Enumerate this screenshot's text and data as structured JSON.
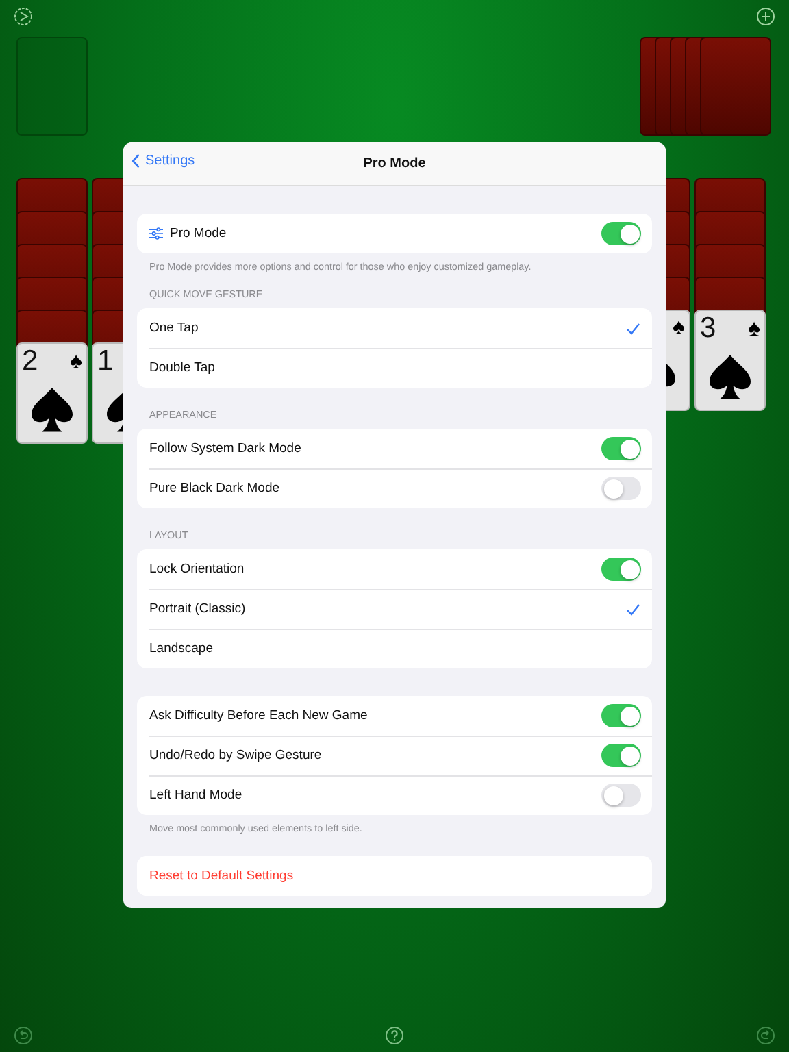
{
  "board": {
    "stock": [
      {
        "kind": "back"
      },
      {
        "kind": "back"
      },
      {
        "kind": "back"
      },
      {
        "kind": "back"
      },
      {
        "kind": "back"
      }
    ],
    "tableau": [
      {
        "cards": [
          {
            "kind": "back"
          },
          {
            "kind": "back"
          },
          {
            "kind": "back"
          },
          {
            "kind": "back"
          },
          {
            "kind": "back"
          },
          {
            "kind": "face",
            "rank": "2",
            "suit": "♠"
          }
        ]
      },
      {
        "cards": [
          {
            "kind": "back"
          },
          {
            "kind": "back"
          },
          {
            "kind": "back"
          },
          {
            "kind": "back"
          },
          {
            "kind": "back"
          },
          {
            "kind": "face",
            "rank": "1"
          }
        ]
      },
      {
        "cards": [
          {
            "kind": "back"
          },
          {
            "kind": "back"
          },
          {
            "kind": "back"
          },
          {
            "kind": "back"
          },
          {
            "kind": "face",
            "suit": "♠"
          }
        ]
      },
      {
        "cards": [
          {
            "kind": "back"
          },
          {
            "kind": "back"
          },
          {
            "kind": "back"
          },
          {
            "kind": "back"
          },
          {
            "kind": "face",
            "rank": "3",
            "suit": "♠"
          }
        ]
      }
    ]
  },
  "settings": {
    "back": "Settings",
    "title": "Pro Mode",
    "sections": [
      {
        "rows": [
          {
            "kind": "icon-toggle",
            "label": "Pro Mode",
            "on": true
          }
        ],
        "footer": "Pro Mode provides more options and control for those who enjoy customized gameplay."
      },
      {
        "header": "QUICK MOVE GESTURE",
        "rows": [
          {
            "kind": "choice",
            "label": "One Tap",
            "selected": true
          },
          {
            "kind": "choice",
            "label": "Double Tap",
            "selected": false
          }
        ]
      },
      {
        "header": "APPEARANCE",
        "rows": [
          {
            "kind": "toggle",
            "label": "Follow System Dark Mode",
            "on": true
          },
          {
            "kind": "toggle",
            "label": "Pure Black Dark Mode",
            "on": false
          }
        ]
      },
      {
        "header": "LAYOUT",
        "rows": [
          {
            "kind": "toggle",
            "label": "Lock Orientation",
            "on": true
          },
          {
            "kind": "choice",
            "label": "Portrait (Classic)",
            "selected": true
          },
          {
            "kind": "choice",
            "label": "Landscape",
            "selected": false
          }
        ]
      },
      {
        "rows": [
          {
            "kind": "toggle",
            "label": "Ask Difficulty Before Each New Game",
            "on": true
          },
          {
            "kind": "toggle",
            "label": "Undo/Redo by Swipe Gesture",
            "on": true
          },
          {
            "kind": "toggle",
            "label": "Left Hand Mode",
            "on": false
          }
        ],
        "footer": "Move most commonly used elements to left side."
      },
      {
        "rows": [
          {
            "kind": "action",
            "label": "Reset to Default Settings"
          }
        ]
      }
    ]
  }
}
